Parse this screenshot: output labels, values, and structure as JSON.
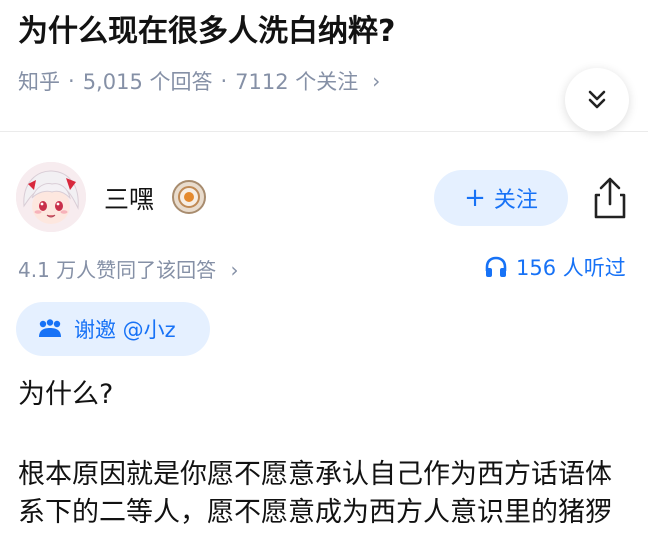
{
  "question": {
    "title": "为什么现在很多人洗白纳粹?",
    "source": "知乎",
    "answers": "5,015 个回答",
    "followers": "7112 个关注",
    "sep": "·",
    "arrow": "›"
  },
  "author": {
    "name": "三嘿",
    "follow_plus": "+",
    "follow_label": "关注"
  },
  "answer": {
    "likes": "4.1 万人赞同了该回答",
    "likes_arrow": "›",
    "listeners": "156 人听过",
    "invite": "谢邀 @小z",
    "paragraphs": [
      "为什么?",
      "根本原因就是你愿不愿意承认自己作为西方话语体系下的二等人，愿不愿意成为西方人意识里的猪猡"
    ]
  },
  "colors": {
    "accent": "#1772f6",
    "accent_bg": "#e5f0ff",
    "meta": "#8590a6",
    "text": "#121212"
  },
  "icons": [
    "chevron-double-down-icon",
    "share-icon",
    "headphones-icon",
    "badge-icon",
    "paw-icon"
  ]
}
